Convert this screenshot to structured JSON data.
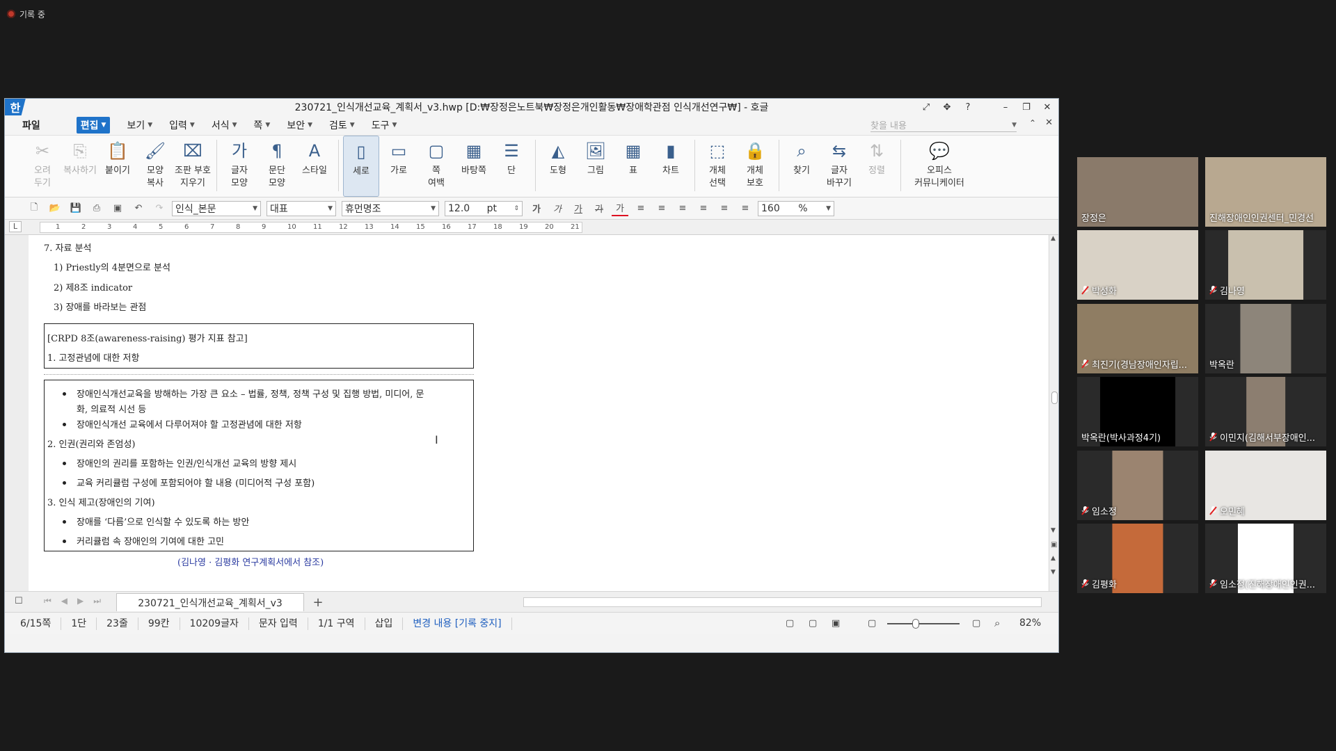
{
  "recording": {
    "label": "기록 중"
  },
  "window": {
    "logo": "한",
    "title": "230721_인식개선교육_계획서_v3.hwp [D:₩장정은노트북₩장정은개인활동₩장애학관점 인식개선연구₩] - 호글",
    "controls": [
      "minimize-icon",
      "restore-icon",
      "close-icon"
    ]
  },
  "menu": {
    "items": [
      {
        "label": "파일"
      },
      {
        "label": "편집",
        "active": true
      },
      {
        "label": "보기"
      },
      {
        "label": "입력"
      },
      {
        "label": "서식"
      },
      {
        "label": "쪽"
      },
      {
        "label": "보안"
      },
      {
        "label": "검토"
      },
      {
        "label": "도구"
      }
    ],
    "search_placeholder": "찾을 내용"
  },
  "ribbon": {
    "groups": [
      [
        {
          "label": "오려\n두기",
          "disabled": true
        },
        {
          "label": "복사하기",
          "disabled": true
        },
        {
          "label": "붙이기"
        },
        {
          "label": "모양\n복사"
        },
        {
          "label": "조판 부호\n지우기"
        }
      ],
      [
        {
          "label": "글자\n모양"
        },
        {
          "label": "문단\n모양"
        },
        {
          "label": "스타일"
        }
      ],
      [
        {
          "label": "세로",
          "selected": true
        },
        {
          "label": "가로"
        },
        {
          "label": "쪽\n여백"
        },
        {
          "label": "바탕쪽"
        },
        {
          "label": "단"
        }
      ],
      [
        {
          "label": "도형"
        },
        {
          "label": "그림"
        },
        {
          "label": "표"
        },
        {
          "label": "차트"
        }
      ],
      [
        {
          "label": "개체\n선택"
        },
        {
          "label": "개체\n보호"
        }
      ],
      [
        {
          "label": "찾기"
        },
        {
          "label": "글자\n바꾸기"
        },
        {
          "label": "정렬",
          "disabled": true
        }
      ],
      [
        {
          "label": "오피스\n커뮤니케이터"
        }
      ]
    ]
  },
  "toolbar": {
    "style": "인식_본문",
    "lang": "대표",
    "font": "휴먼명조",
    "size": "12.0",
    "unit": "pt",
    "zoom": "160",
    "zoom_unit": "%",
    "char_icons": [
      "가",
      "가",
      "가",
      "가",
      "가"
    ]
  },
  "ruler": {
    "ticks": [
      "1",
      "2",
      "3",
      "4",
      "5",
      "6",
      "7",
      "8",
      "9",
      "10",
      "11",
      "12",
      "13",
      "14",
      "15",
      "16",
      "17",
      "18",
      "19",
      "20",
      "21"
    ]
  },
  "document": {
    "h7": "7. 자료 분석",
    "l1": "1) Priestly의 4분면으로 분석",
    "l2": "2) 제8조 indicator",
    "l3": "3) 장애를 바라보는 관점",
    "box1_title": "[CRPD 8조(awareness-raising) 평가 지표 참고]",
    "box1_item": "1. 고정관념에 대한 저항",
    "b1": "장애인식개선교육을 방해하는 가장 큰 요소 – 법률, 정책, 정책 구성 및 집행 방법, 미디어, 문",
    "b1b": "화, 의료적 시선 등",
    "b2": "장애인식개선 교육에서 다루어져야 할 고정관념에 대한 저항",
    "s2": "2. 인권(권리와 존엄성)",
    "b3": "장애인의 권리를 포함하는 인권/인식개선 교육의 방향 제시",
    "b4": "교육 커리큘럼 구성에 포함되어야 할 내용 (미디어적 구성 포함)",
    "s3": "3. 인식 제고(장애인의 기여)",
    "b5": "장애를 ‘다름’으로 인식할 수 있도록 하는 방안",
    "b6": "커리큘럼 속 장애인의 기여에 대한 고민",
    "note": "(김나영 · 김평화 연구계획서에서 참조)"
  },
  "tabs": {
    "doc_tab": "230721_인식개선교육_계획서_v3",
    "add": "+"
  },
  "status": {
    "items": [
      "6/15쪽",
      "1단",
      "23줄",
      "99칸",
      "10209글자",
      "문자 입력",
      "1/1 구역",
      "삽입",
      "변경 내용 [기록 중지]"
    ],
    "zoom": "82%"
  },
  "participants": [
    {
      "name": "장정은",
      "muted": false,
      "highlight": true,
      "bg": "#8a7a6a",
      "w": 1.0
    },
    {
      "name": "진해장애인인권센터_민경선",
      "muted": false,
      "bg": "#b8a890",
      "w": 1.0
    },
    {
      "name": "박성화",
      "muted": true,
      "bg": "#d9d2c6",
      "w": 1.0
    },
    {
      "name": "김나영",
      "muted": true,
      "bg": "#c9c0ae",
      "w": 0.62
    },
    {
      "name": "최진기(경남장애인자립...",
      "muted": true,
      "bg": "#8f7d63",
      "w": 1.0
    },
    {
      "name": "박옥란",
      "muted": false,
      "bg": "#8d857a",
      "w": 0.42
    },
    {
      "name": "박옥란(박사과정4기)",
      "muted": false,
      "bg": "#000000",
      "w": 0.62
    },
    {
      "name": "이민지(김해서부장애인...",
      "muted": true,
      "bg": "#8c7e70",
      "w": 0.32
    },
    {
      "name": "임소정",
      "muted": true,
      "bg": "#9b8470",
      "w": 0.42
    },
    {
      "name": "오민혜",
      "muted": true,
      "bg": "#e8e6e3",
      "w": 1.0
    },
    {
      "name": "김평화",
      "muted": true,
      "bg": "#c56a3a",
      "w": 0.42
    },
    {
      "name": "임소정(진해장애인인권...",
      "muted": true,
      "bg": "#ffffff",
      "w": 0.46
    }
  ]
}
